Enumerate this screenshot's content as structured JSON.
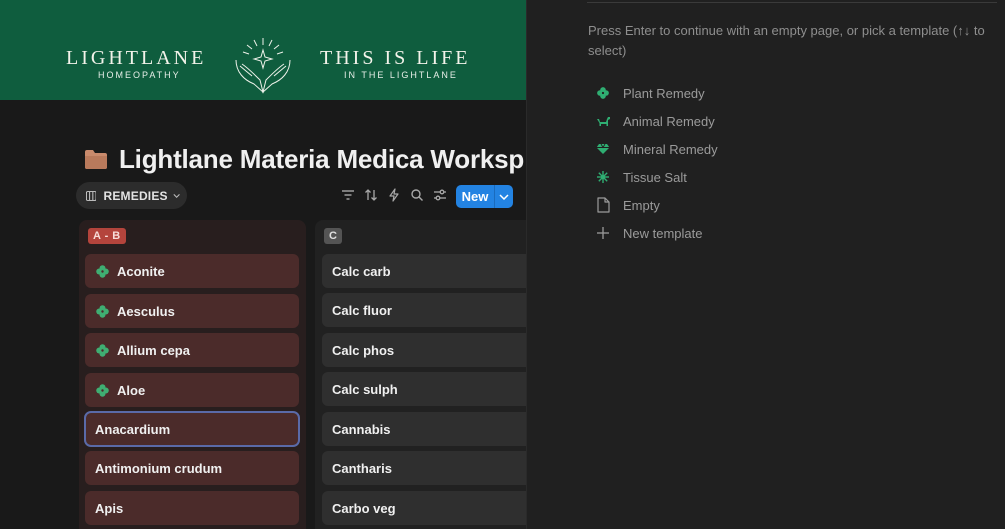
{
  "banner": {
    "brand_left_title": "LIGHTLANE",
    "brand_left_sub": "HOMEOPATHY",
    "brand_right_title": "THIS IS LIFE",
    "brand_right_sub": "IN THE LIGHTLANE",
    "background": "#0f5d3e"
  },
  "page": {
    "title": "Lightlane Materia Medica Worksp",
    "icon": "folder-icon"
  },
  "view": {
    "label": "REMEDIES"
  },
  "toolbar": {
    "tools": [
      "filter-icon",
      "sort-icon",
      "automation-lightning-icon",
      "search-icon",
      "settings-sliders-icon"
    ],
    "new_label": "New",
    "accent": "#2383e2"
  },
  "columns": [
    {
      "label": "A - B",
      "color": "#b4443c",
      "cards": [
        {
          "title": "Aconite",
          "icon": "clover-icon"
        },
        {
          "title": "Aesculus",
          "icon": "clover-icon"
        },
        {
          "title": "Allium cepa",
          "icon": "clover-icon"
        },
        {
          "title": "Aloe",
          "icon": "clover-icon"
        },
        {
          "title": "Anacardium",
          "icon": ""
        },
        {
          "title": "Antimonium crudum",
          "icon": ""
        },
        {
          "title": "Apis",
          "icon": ""
        }
      ]
    },
    {
      "label": "C",
      "color": "#545454",
      "cards": [
        {
          "title": "Calc carb"
        },
        {
          "title": "Calc fluor"
        },
        {
          "title": "Calc phos"
        },
        {
          "title": "Calc sulph"
        },
        {
          "title": "Cannabis"
        },
        {
          "title": "Cantharis"
        },
        {
          "title": "Carbo veg"
        }
      ]
    }
  ],
  "template_panel": {
    "hint": "Press Enter to continue with an empty page, or pick a template (↑↓ to select)",
    "templates": [
      {
        "label": "Plant Remedy",
        "icon": "clover-icon"
      },
      {
        "label": "Animal Remedy",
        "icon": "dog-icon"
      },
      {
        "label": "Mineral Remedy",
        "icon": "gem-icon"
      },
      {
        "label": "Tissue Salt",
        "icon": "sparkle-icon"
      },
      {
        "label": "Empty",
        "icon": "page-icon"
      },
      {
        "label": "New template",
        "icon": "plus-icon"
      }
    ],
    "icon_color": "#2fae72"
  }
}
